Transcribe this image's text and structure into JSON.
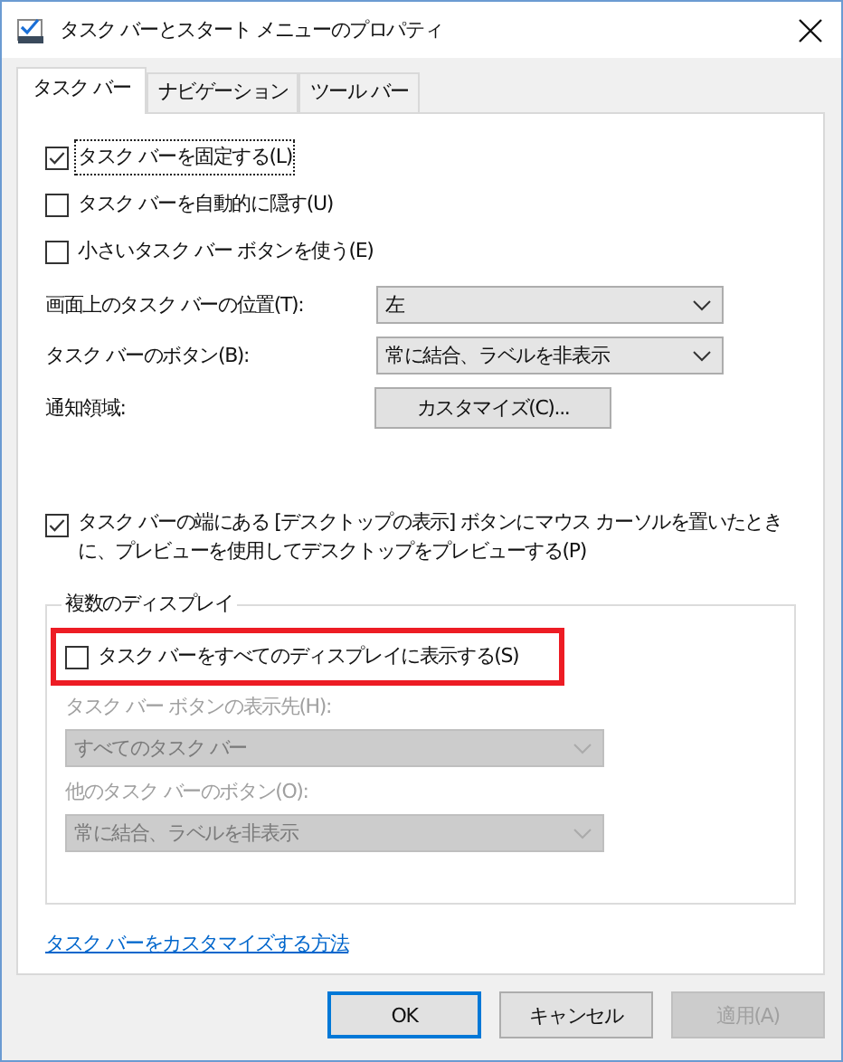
{
  "window": {
    "title": "タスク バーとスタート メニューのプロパティ"
  },
  "tabs": [
    {
      "label": "タスク バー",
      "selected": true
    },
    {
      "label": "ナビゲーション",
      "selected": false
    },
    {
      "label": "ツール バー",
      "selected": false
    }
  ],
  "checkboxes": [
    {
      "label": "タスク バーを固定する(L)",
      "checked": true,
      "focused": true
    },
    {
      "label": "タスク バーを自動的に隠す(U)",
      "checked": false,
      "focused": false
    },
    {
      "label": "小さいタスク バー ボタンを使う(E)",
      "checked": false,
      "focused": false
    }
  ],
  "settings": [
    {
      "kind": "dropdown",
      "label": "画面上のタスク バーの位置(T):",
      "value": "左"
    },
    {
      "kind": "dropdown",
      "label": "タスク バーのボタン(B):",
      "value": "常に結合、ラベルを非表示"
    },
    {
      "kind": "button",
      "label": "通知領域:",
      "value": "カスタマイズ(C)..."
    }
  ],
  "peek_checkbox": {
    "label": "タスク バーの端にある [デスクトップの表示] ボタンにマウス カーソルを置いたときに、プレビューを使用してデスクトップをプレビューする(P)",
    "checked": true
  },
  "multi_display": {
    "title": "複数のディスプレイ",
    "show_all": {
      "label": "タスク バーをすべてのディスプレイに表示する(S)",
      "checked": false,
      "highlighted": true
    },
    "fields": [
      {
        "label": "タスク バー ボタンの表示先(H):",
        "value": "すべてのタスク バー",
        "disabled": true
      },
      {
        "label": "他のタスク バーのボタン(O):",
        "value": "常に結合、ラベルを非表示",
        "disabled": true
      }
    ]
  },
  "help_link": "タスク バーをカスタマイズする方法",
  "buttons": [
    {
      "label": "OK",
      "default": true,
      "disabled": false
    },
    {
      "label": "キャンセル",
      "default": false,
      "disabled": false
    },
    {
      "label": "適用(A)",
      "default": false,
      "disabled": true
    }
  ]
}
